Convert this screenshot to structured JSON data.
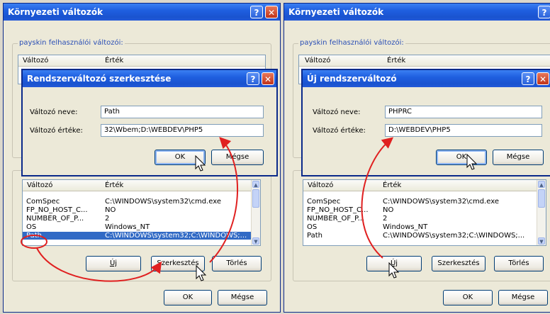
{
  "left_window": {
    "title": "Környezeti változók",
    "user_group_label": "payskin felhasználói változói:",
    "top_list": {
      "col1": "Változó",
      "col2": "Érték"
    },
    "sys_list": {
      "col1": "Változó",
      "col2": "Érték",
      "rows": [
        {
          "name": "ComSpec",
          "value": "C:\\WINDOWS\\system32\\cmd.exe"
        },
        {
          "name": "FP_NO_HOST_C...",
          "value": "NO"
        },
        {
          "name": "NUMBER_OF_P...",
          "value": "2"
        },
        {
          "name": "OS",
          "value": "Windows_NT"
        },
        {
          "name": "Path",
          "value": "C:\\WINDOWS\\system32;C:\\WINDOWS;..."
        }
      ]
    },
    "new_button": "Új",
    "edit_button": "Szerkesztés",
    "delete_button": "Törlés",
    "ok_button": "OK",
    "cancel_button": "Mégse"
  },
  "edit_dialog": {
    "title": "Rendszerváltozó szerkesztése",
    "name_label": "Változó neve:",
    "value_label": "Változó értéke:",
    "name_value": "Path",
    "value_value": "32\\Wbem;D:\\WEBDEV\\PHP5",
    "ok_button": "OK",
    "cancel_button": "Mégse"
  },
  "right_window": {
    "title": "Környezeti változók",
    "user_group_label": "payskin felhasználói változói:",
    "top_list": {
      "col1": "Változó",
      "col2": "Érték"
    },
    "sys_list": {
      "col1": "Változó",
      "col2": "Érték",
      "rows": [
        {
          "name": "ComSpec",
          "value": "C:\\WINDOWS\\system32\\cmd.exe"
        },
        {
          "name": "FP_NO_HOST_C...",
          "value": "NO"
        },
        {
          "name": "NUMBER_OF_P...",
          "value": "2"
        },
        {
          "name": "OS",
          "value": "Windows_NT"
        },
        {
          "name": "Path",
          "value": "C:\\WINDOWS\\system32;C:\\WINDOWS;..."
        }
      ]
    },
    "new_button": "Új",
    "edit_button": "Szerkesztés",
    "delete_button": "Törlés",
    "ok_button": "OK",
    "cancel_button": "Mégse"
  },
  "new_dialog": {
    "title": "Új rendszerváltozó",
    "name_label": "Változó neve:",
    "value_label": "Változó értéke:",
    "name_value": "PHPRC",
    "value_value": "D:\\WEBDEV\\PHP5",
    "ok_button": "OK",
    "cancel_button": "Mégse"
  },
  "icons": {
    "help": "?",
    "close": "✕",
    "scroll_up": "▲",
    "scroll_down": "▼"
  },
  "colors": {
    "titlebar": "#1f5fe0",
    "selection": "#316ac5",
    "annotation": "#e02020"
  }
}
